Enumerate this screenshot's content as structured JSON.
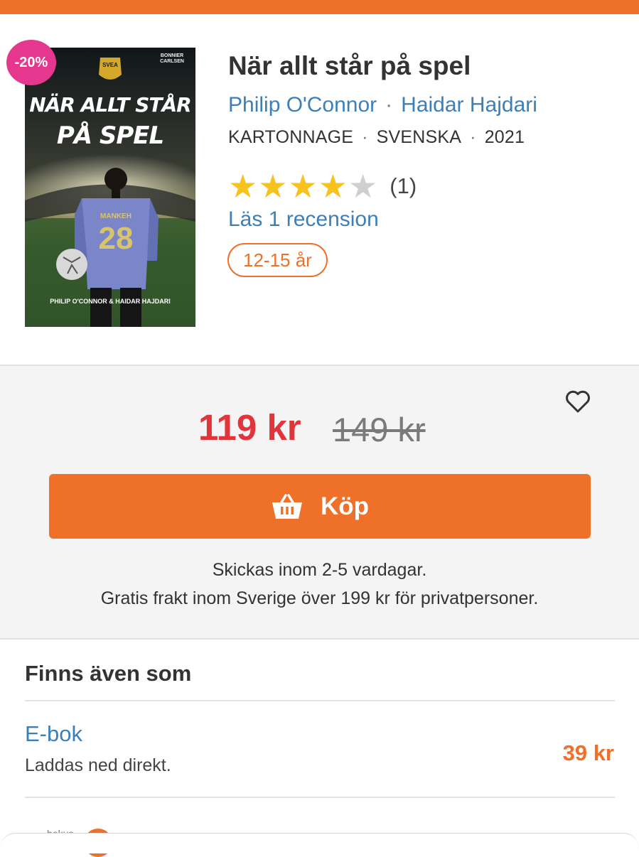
{
  "product": {
    "discount_badge": "-20%",
    "title": "När allt står på spel",
    "authors": [
      "Philip O'Connor",
      "Haidar Hajdari"
    ],
    "author_separator": "·",
    "format": "KARTONNAGE",
    "language": "SVENSKA",
    "year": "2021",
    "rating": {
      "value": 4,
      "max": 5,
      "count_label": "(1)"
    },
    "review_link": "Läs 1 recension",
    "age_tag": "12-15 år",
    "cover": {
      "publisher": "BONNIER CARLSEN",
      "badge_text": "SVEA",
      "title_line1": "NÄR ALLT STÅR",
      "title_line2": "PÅ SPEL",
      "jersey_name": "MANKEH",
      "jersey_number": "28",
      "authors_line": "PHILIP O'CONNOR & HAIDAR HAJDARI"
    }
  },
  "buy": {
    "price": "119 kr",
    "old_price": "149 kr",
    "button_label": "Köp",
    "shipping_time": "Skickas inom 2-5 vardagar.",
    "shipping_free": "Gratis frakt inom Sverige över 199 kr för privatpersoner."
  },
  "formats": {
    "heading": "Finns även som",
    "items": [
      {
        "name": "E-bok",
        "description": "Laddas ned direkt.",
        "price": "39 kr"
      }
    ]
  },
  "bottom": {
    "logo_text": "bokus"
  },
  "colors": {
    "accent": "#ee7029",
    "link": "#3d7fb7",
    "sale": "#e0353b",
    "badge": "#e6378f",
    "star": "#f7c21d"
  },
  "icons": {
    "favorite": "heart-icon",
    "cart": "basket-icon",
    "star": "star-icon"
  }
}
